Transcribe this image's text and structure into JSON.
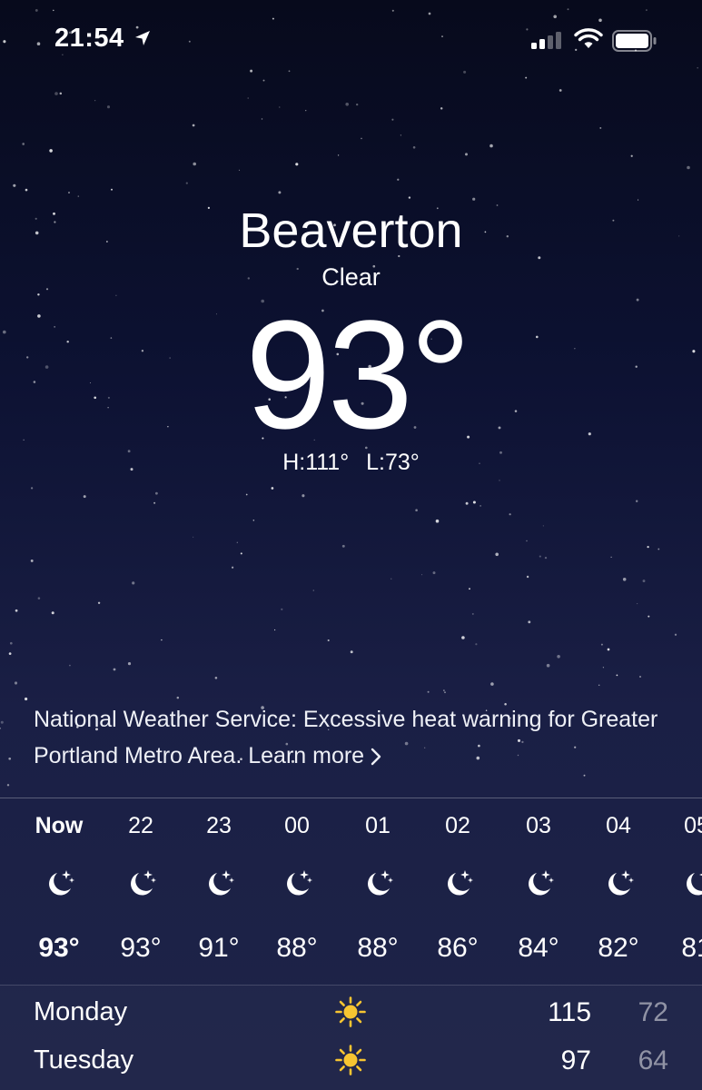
{
  "status_bar": {
    "time": "21:54",
    "icons": [
      "location-arrow-icon",
      "cellular-signal-icon",
      "wifi-icon",
      "battery-icon"
    ]
  },
  "location": {
    "city": "Beaverton",
    "condition": "Clear",
    "temperature": "93°",
    "high": "H:111°",
    "low": "L:73°"
  },
  "alert": {
    "text": "National Weather Service: Excessive heat warning for Greater Portland Metro Area. Learn more",
    "icon": "chevron-right-icon"
  },
  "hourly": [
    {
      "label": "Now",
      "icon": "moon-stars-icon",
      "temp": "93°"
    },
    {
      "label": "22",
      "icon": "moon-stars-icon",
      "temp": "93°"
    },
    {
      "label": "23",
      "icon": "moon-stars-icon",
      "temp": "91°"
    },
    {
      "label": "00",
      "icon": "moon-stars-icon",
      "temp": "88°"
    },
    {
      "label": "01",
      "icon": "moon-stars-icon",
      "temp": "88°"
    },
    {
      "label": "02",
      "icon": "moon-stars-icon",
      "temp": "86°"
    },
    {
      "label": "03",
      "icon": "moon-stars-icon",
      "temp": "84°"
    },
    {
      "label": "04",
      "icon": "moon-stars-icon",
      "temp": "82°"
    },
    {
      "label": "05",
      "icon": "moon-stars-icon",
      "temp": "81"
    }
  ],
  "daily": [
    {
      "day": "Monday",
      "icon": "sun-icon",
      "high": "115",
      "low": "72"
    },
    {
      "day": "Tuesday",
      "icon": "sun-icon",
      "high": "97",
      "low": "64"
    }
  ],
  "colors": {
    "sun": "#f7c531",
    "background_top": "#070a1c",
    "background_bottom": "#1e2448"
  }
}
